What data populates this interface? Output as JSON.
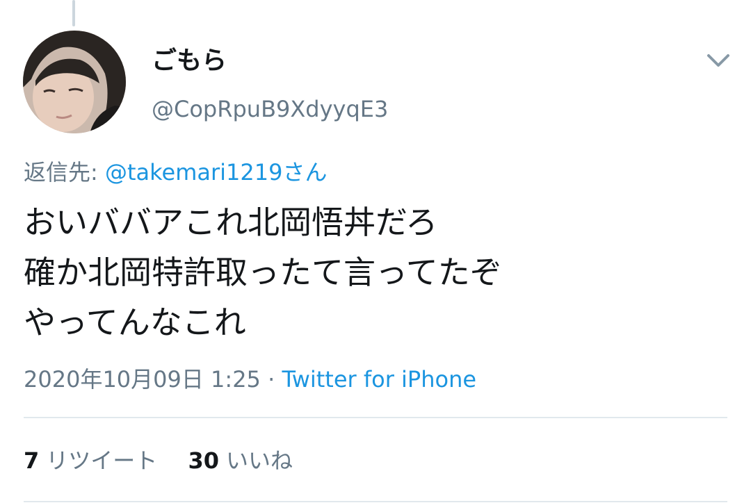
{
  "user": {
    "display_name": "ごもら",
    "handle": "@CopRpuB9XdyyqE3"
  },
  "reply": {
    "prefix": "返信先: ",
    "mention": "@takemari1219さん"
  },
  "tweet": {
    "lines": [
      "おいババアこれ北岡悟丼だろ",
      "確か北岡特許取ったて言ってたぞ",
      "やってんなこれ"
    ]
  },
  "meta": {
    "timestamp": "2020年10月09日 1:25",
    "separator": " · ",
    "source": "Twitter for iPhone"
  },
  "stats": {
    "retweet_count": "7",
    "retweet_label": "リツイート",
    "like_count": "30",
    "like_label": "いいね"
  },
  "icons": {
    "caret": "chevron-down-icon"
  },
  "colors": {
    "text": "#14171a",
    "secondary": "#657786",
    "link": "#1b95e0",
    "divider": "#e1e8ed"
  }
}
